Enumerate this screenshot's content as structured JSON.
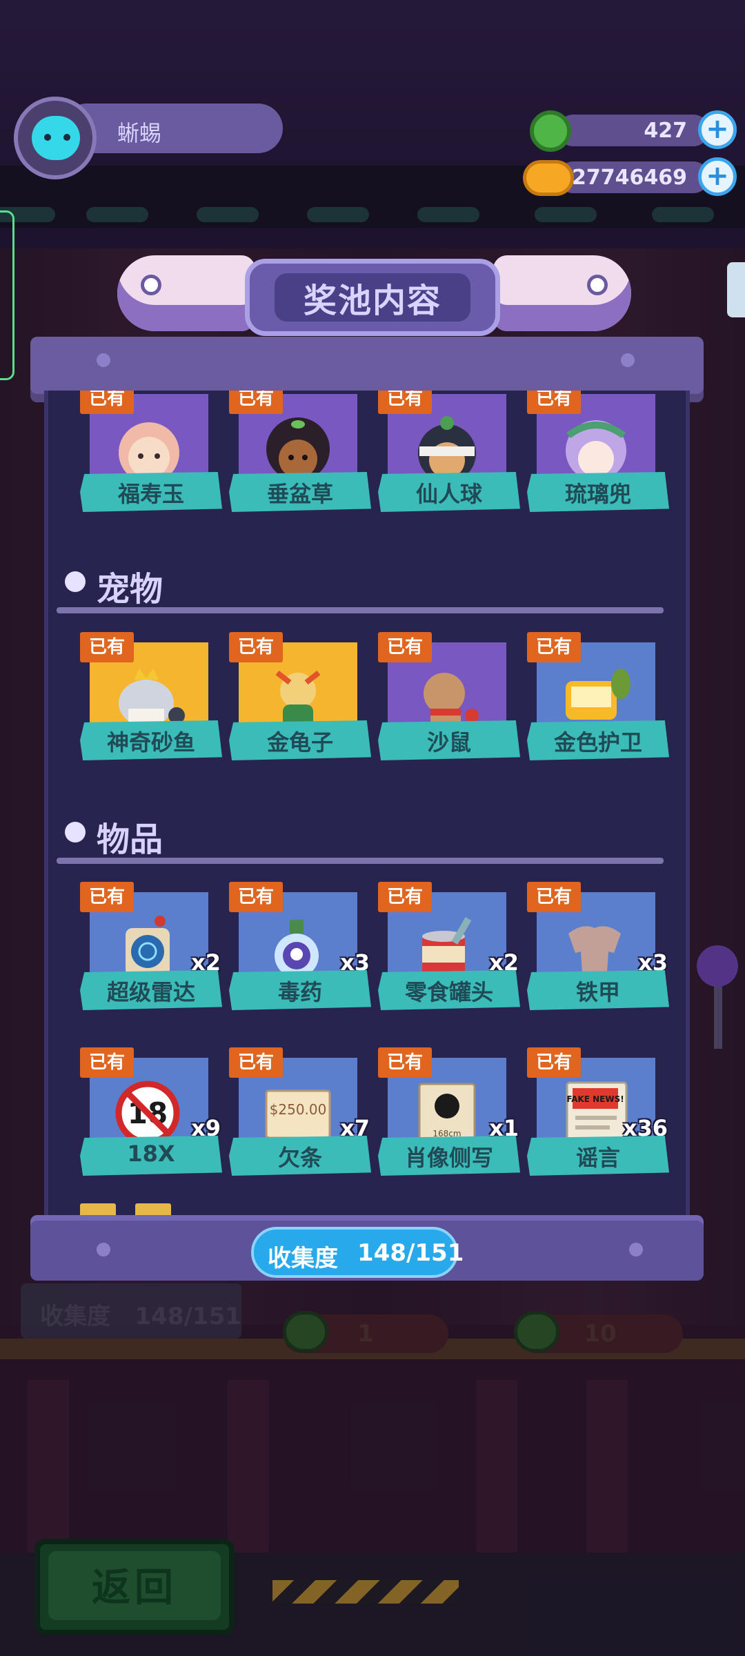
{
  "player": {
    "name": "蜥蜴"
  },
  "currencies": [
    {
      "name": "green-coin",
      "value": "427",
      "color": "#4fb546"
    },
    {
      "name": "gold-planet",
      "value": "27746469",
      "color": "#f6a825"
    }
  ],
  "panel": {
    "title": "奖池内容",
    "owned_badge": "已有",
    "sections": [
      {
        "title": "",
        "items": [
          {
            "name": "福寿玉",
            "count": "",
            "card": "purple"
          },
          {
            "name": "垂盆草",
            "count": "",
            "card": "purple"
          },
          {
            "name": "仙人球",
            "count": "",
            "card": "purple"
          },
          {
            "name": "琉璃兜",
            "count": "",
            "card": "purple"
          }
        ]
      },
      {
        "title": "宠物",
        "items": [
          {
            "name": "神奇砂鱼",
            "count": "",
            "card": "gold"
          },
          {
            "name": "金龟子",
            "count": "",
            "card": "gold"
          },
          {
            "name": "沙鼠",
            "count": "",
            "card": "purple"
          },
          {
            "name": "金色护卫",
            "count": "",
            "card": "blue"
          }
        ]
      },
      {
        "title": "物品",
        "items": [
          {
            "name": "超级雷达",
            "count": "x2",
            "card": "blue"
          },
          {
            "name": "毒药",
            "count": "x3",
            "card": "blue"
          },
          {
            "name": "零食罐头",
            "count": "x2",
            "card": "blue"
          },
          {
            "name": "铁甲",
            "count": "x3",
            "card": "blue"
          },
          {
            "name": "18X",
            "count": "x9",
            "card": "blue"
          },
          {
            "name": "欠条",
            "count": "x7",
            "card": "blue"
          },
          {
            "name": "肖像侧写",
            "count": "x1",
            "card": "blue"
          },
          {
            "name": "谣言",
            "count": "x36",
            "card": "blue"
          }
        ]
      }
    ],
    "item_art_text": {
      "18X": "18",
      "欠条": "$250.00",
      "肖像侧写": "168cm",
      "谣言": "FAKE NEWS!"
    },
    "progress": {
      "label": "收集度",
      "value": "148/151"
    }
  },
  "background": {
    "collection_label": "收集度",
    "collection_value": "148/151",
    "buy_one": "1",
    "buy_ten": "10"
  },
  "back_button": {
    "label": "返回"
  },
  "colors": {
    "panel": "#282450",
    "label_teal": "#3cbcb8",
    "owned_orange": "#e0661f",
    "progress_blue": "#27a9ec"
  }
}
